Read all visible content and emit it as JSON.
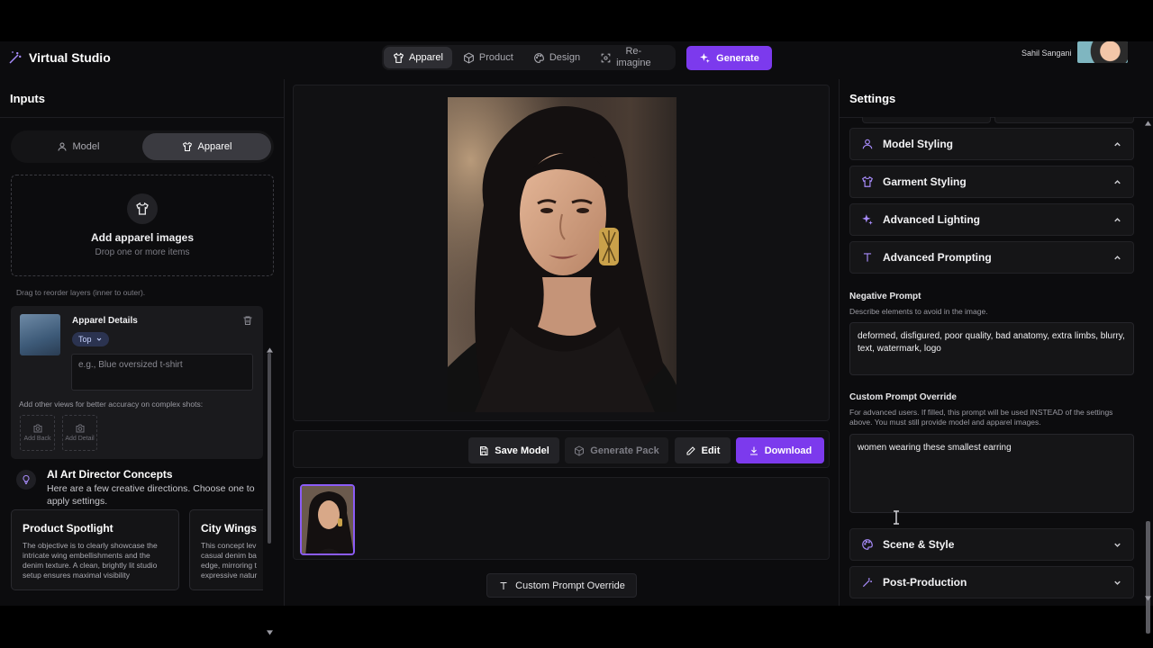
{
  "app": {
    "name": "Virtual Studio",
    "generate_label": "Generate",
    "user_name": "Sahil Sangani"
  },
  "modes": [
    {
      "label": "Apparel",
      "icon": "shirt-icon"
    },
    {
      "label": "Product",
      "icon": "box-icon"
    },
    {
      "label": "Design",
      "icon": "palette-icon"
    },
    {
      "label": "Re-\nimagine",
      "icon": "scan-icon"
    }
  ],
  "inputs": {
    "title": "Inputs",
    "tabs": [
      {
        "label": "Model"
      },
      {
        "label": "Apparel"
      }
    ],
    "dropzone": {
      "title": "Add apparel images",
      "subtitle": "Drop one or more items"
    },
    "reorder_hint": "Drag to reorder layers (inner to outer).",
    "apparel_card": {
      "title": "Apparel Details",
      "category": "Top",
      "placeholder": "e.g., Blue oversized t-shirt",
      "views_hint": "Add other views for better accuracy on complex shots:",
      "views": [
        "Add Back",
        "Add Detail"
      ]
    },
    "concepts": {
      "title": "AI Art Director Concepts",
      "subtitle": "Here are a few creative directions. Choose one to apply settings.",
      "cards": [
        {
          "title": "Product Spotlight",
          "text": "The objective is to clearly showcase the intricate wing embellishments and the denim texture. A clean, brightly lit studio setup ensures maximal visibility"
        },
        {
          "title": "City Wings",
          "text": "This concept lev casual denim ba edge, mirroring t expressive natur"
        }
      ]
    }
  },
  "actions": {
    "save_model": "Save Model",
    "generate_pack": "Generate Pack",
    "edit": "Edit",
    "download": "Download",
    "custom_prompt_override": "Custom Prompt Override"
  },
  "settings": {
    "title": "Settings",
    "sections_top": [
      {
        "label": "Model Styling",
        "icon": "user-icon"
      },
      {
        "label": "Garment Styling",
        "icon": "shirt-icon"
      },
      {
        "label": "Advanced Lighting",
        "icon": "sparkles-icon"
      },
      {
        "label": "Advanced Prompting",
        "icon": "text-icon"
      }
    ],
    "negative_prompt": {
      "label": "Negative Prompt",
      "help": "Describe elements to avoid in the image.",
      "value": "deformed, disfigured, poor quality, bad anatomy, extra limbs, blurry, text, watermark, logo"
    },
    "custom_prompt": {
      "label": "Custom Prompt Override",
      "help": "For advanced users. If filled, this prompt will be used INSTEAD of the settings above. You must still provide model and apparel images.",
      "value": "women wearing these smallest earring"
    },
    "sections_bottom": [
      {
        "label": "Scene & Style",
        "icon": "palette-icon"
      },
      {
        "label": "Post-Production",
        "icon": "wand-icon"
      }
    ]
  },
  "colors": {
    "accent": "#7c3aed",
    "background": "#0c0c0e",
    "panel": "#151517"
  }
}
